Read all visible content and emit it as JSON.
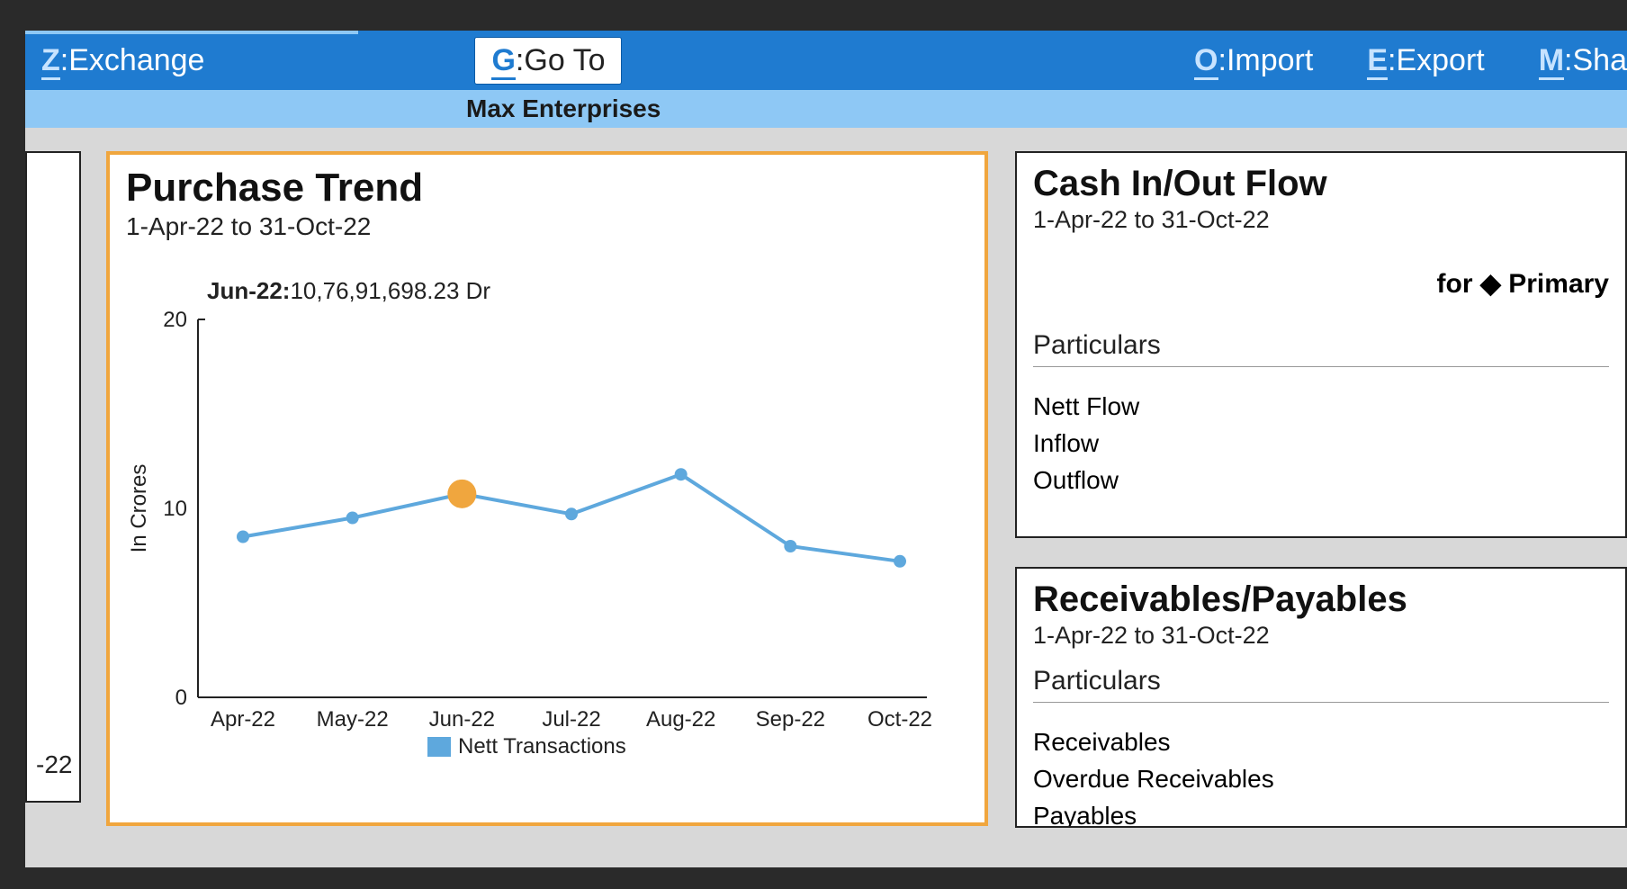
{
  "ribbon": {
    "exchange": {
      "key": "Z",
      "label": "Exchange"
    },
    "goto": {
      "key": "G",
      "label": "Go To"
    },
    "import": {
      "key": "O",
      "label": "Import"
    },
    "export": {
      "key": "E",
      "label": "Export"
    },
    "share": {
      "key": "M",
      "label": "Sha"
    }
  },
  "company_name": "Max Enterprises",
  "left_sliver_label": "-22",
  "chart": {
    "title": "Purchase Trend",
    "subtitle": "1-Apr-22 to 31-Oct-22",
    "tooltip_label": "Jun-22:",
    "tooltip_value": "10,76,91,698.23 Dr",
    "y_label": "In Crores",
    "y_ticks": [
      "0",
      "10",
      "20"
    ],
    "legend": "Nett Transactions"
  },
  "chart_data": {
    "type": "line",
    "title": "Purchase Trend",
    "xlabel": "",
    "ylabel": "In Crores",
    "ylim": [
      0,
      20
    ],
    "categories": [
      "Apr-22",
      "May-22",
      "Jun-22",
      "Jul-22",
      "Aug-22",
      "Sep-22",
      "Oct-22"
    ],
    "series": [
      {
        "name": "Nett Transactions",
        "values": [
          8.5,
          9.5,
          10.77,
          9.7,
          11.8,
          8.0,
          7.2
        ]
      }
    ],
    "highlight_index": 2,
    "highlight_value_text": "10,76,91,698.23 Dr",
    "legend_position": "bottom"
  },
  "cash_panel": {
    "title": "Cash In/Out Flow",
    "subtitle": "1-Apr-22 to 31-Oct-22",
    "for_text": "for ◆ Primary",
    "section_head": "Particulars",
    "rows": [
      "Nett Flow",
      "Inflow",
      "Outflow"
    ]
  },
  "recv_panel": {
    "title": "Receivables/Payables",
    "subtitle": "1-Apr-22 to 31-Oct-22",
    "section_head": "Particulars",
    "rows": [
      "Receivables",
      "Overdue Receivables",
      "Payables"
    ]
  }
}
